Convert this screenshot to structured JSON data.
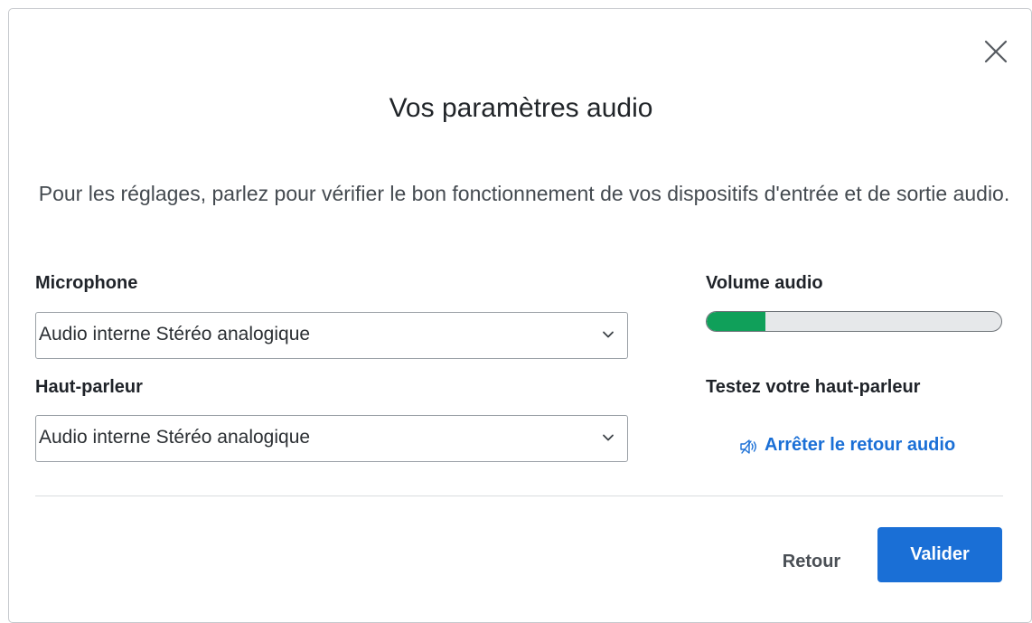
{
  "dialog": {
    "title": "Vos paramètres audio",
    "description": "Pour les réglages, parlez pour vérifier le bon fonctionnement de vos dispositifs d'entrée et de sortie audio.",
    "close_icon": "close-icon"
  },
  "microphone": {
    "label": "Microphone",
    "selected": "Audio interne Stéréo analogique"
  },
  "speaker": {
    "label": "Haut-parleur",
    "selected": "Audio interne Stéréo analogique"
  },
  "volume": {
    "label": "Volume audio",
    "level_fraction": 0.2,
    "fill_color": "#10a05a"
  },
  "speaker_test": {
    "label": "Testez votre haut-parleur",
    "stop_link": "Arrêter le retour audio",
    "icon": "speaker-icon"
  },
  "footer": {
    "back_label": "Retour",
    "validate_label": "Valider"
  },
  "colors": {
    "accent": "#1a6fd6",
    "volume_fill": "#10a05a"
  }
}
